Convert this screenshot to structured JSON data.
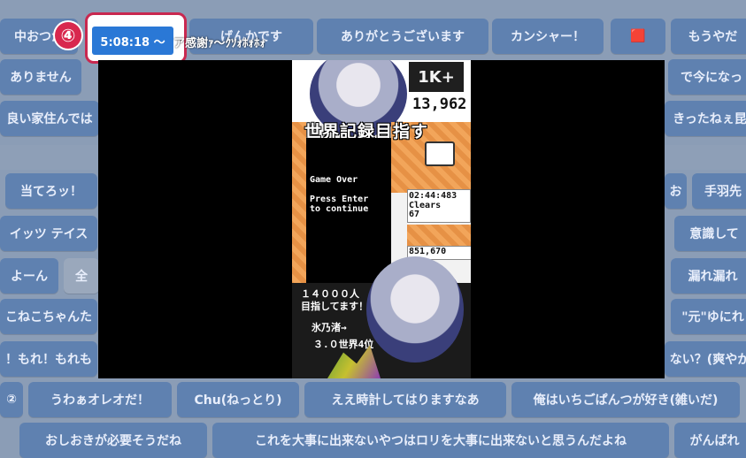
{
  "top_row": [
    "中おつか",
    "げんかです",
    "ありがとうございます",
    "カンシャー！",
    "🟥",
    "もうやだ"
  ],
  "row2": [
    "ありません",
    "で今になっ"
  ],
  "row3": [
    "良い家住んでは",
    "きったねぇ昆"
  ],
  "left_col": [
    "当てろッ！",
    "イッツ テイス",
    "よーん",
    "全",
    "こねこちゃんた",
    "！もれ！もれも"
  ],
  "right_col": [
    "お",
    "手羽先",
    "意識して",
    "漏れ漏れ",
    "\"元\"ゆにれ",
    "ない？(爽やか"
  ],
  "row_bottom1": [
    "②",
    "うわぁオレオだ！",
    "Chu(ねっとり)",
    "ええ時計してはりますなあ",
    "俺はいちごぱんつが好き(雑いだ)"
  ],
  "row_bottom2": [
    "おしおきが必要そうだね",
    "これを大事に出来ないやつはロリを大事に出来ないと思うんだよね",
    "がんばれ"
  ],
  "timestamp": {
    "step": "④",
    "time": "5:08:18 〜",
    "caption": "ア感謝ｧ〜ｸｿｫﾎｫﾎｫ"
  },
  "video": {
    "score": "13,962",
    "title": "世界記録目指す",
    "game_over": "Game Over",
    "press_enter": "Press Enter",
    "to_continue": "to continue",
    "timer": "02:44:483",
    "clears_label": "Clears",
    "clears_value": "67",
    "bottom_score": "851,670",
    "goal1": "１４０００人",
    "goal2": "目指してます！",
    "rank1": "氷乃渚→",
    "rank2": "３.０世界4位",
    "badge": "1K+"
  }
}
